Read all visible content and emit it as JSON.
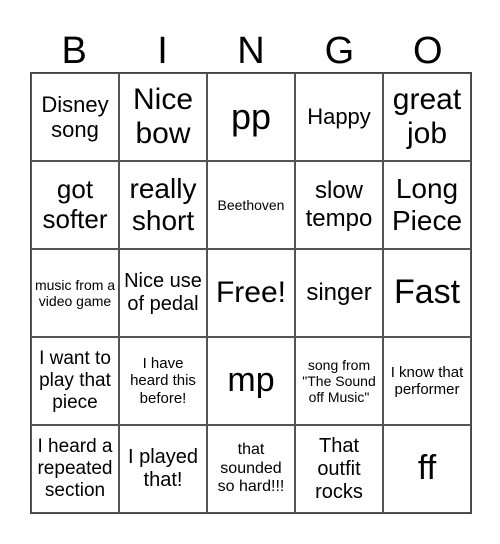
{
  "header": [
    "B",
    "I",
    "N",
    "G",
    "O"
  ],
  "cells": [
    "Disney song",
    "Nice bow",
    "pp",
    "Happy",
    "great job",
    "got softer",
    "really short",
    "Beethoven",
    "slow tempo",
    "Long Piece",
    "music from a video game",
    "Nice use of pedal",
    "Free!",
    "singer",
    "Fast",
    "I want to play that piece",
    "I have heard this before!",
    "mp",
    "song from \"The Sound off Music\"",
    "I know that performer",
    "I heard a repeated section",
    "I played that!",
    "that sounded so hard!!!",
    "That outfit rocks",
    "ff"
  ]
}
